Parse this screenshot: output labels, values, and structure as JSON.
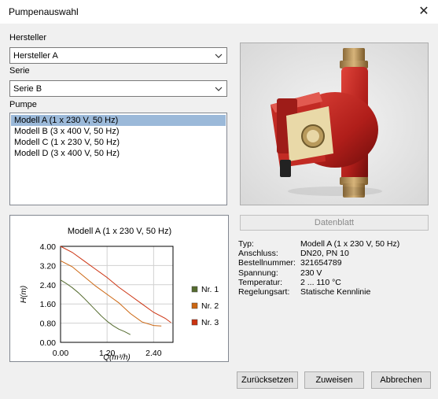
{
  "window": {
    "title": "Pumpenauswahl",
    "close_glyph": "✕"
  },
  "manufacturer": {
    "label": "Hersteller",
    "value": "Hersteller A"
  },
  "series": {
    "label": "Serie",
    "value": "Serie B"
  },
  "pump": {
    "label": "Pumpe",
    "items": [
      "Modell A (1 x 230 V, 50 Hz)",
      "Modell B (3 x 400 V, 50 Hz)",
      "Modell C (1 x 230 V, 50 Hz)",
      "Modell D (3 x 400 V, 50 Hz)"
    ],
    "selected_index": 0
  },
  "chart_data": {
    "type": "line",
    "title": "Modell A (1 x 230 V, 50 Hz)",
    "xlabel": "Q(m³/h)",
    "ylabel": "H(m)",
    "xlim": [
      0,
      2.9
    ],
    "ylim": [
      0,
      4.0
    ],
    "xticks": [
      "0.00",
      "1.20",
      "2.40"
    ],
    "yticks": [
      "0.00",
      "0.80",
      "1.60",
      "2.40",
      "3.20",
      "4.00"
    ],
    "grid": true,
    "legend_position": "right",
    "series": [
      {
        "name": "Nr. 1",
        "color": "#556b2f",
        "x": [
          0.0,
          0.15,
          0.3,
          0.45,
          0.6,
          0.75,
          0.9,
          1.05,
          1.2,
          1.35,
          1.5,
          1.65,
          1.8
        ],
        "y": [
          2.6,
          2.45,
          2.28,
          2.08,
          1.85,
          1.6,
          1.35,
          1.1,
          0.88,
          0.7,
          0.55,
          0.45,
          0.32
        ]
      },
      {
        "name": "Nr. 2",
        "color": "#cc6611",
        "x": [
          0.0,
          0.3,
          0.6,
          0.9,
          1.2,
          1.5,
          1.8,
          2.1,
          2.4,
          2.6
        ],
        "y": [
          3.4,
          3.15,
          2.75,
          2.35,
          2.0,
          1.65,
          1.2,
          0.85,
          0.7,
          0.68
        ]
      },
      {
        "name": "Nr. 3",
        "color": "#cc3311",
        "x": [
          0.0,
          0.3,
          0.6,
          0.9,
          1.2,
          1.5,
          1.8,
          2.1,
          2.4,
          2.7,
          2.85
        ],
        "y": [
          4.0,
          3.75,
          3.4,
          3.05,
          2.7,
          2.3,
          1.95,
          1.6,
          1.25,
          1.0,
          0.82
        ]
      }
    ]
  },
  "details": {
    "datasheet_label": "Datenblatt",
    "rows": [
      {
        "key": "Typ:",
        "value": "Modell A (1 x 230 V, 50 Hz)"
      },
      {
        "key": "Anschluss:",
        "value": "DN20, PN 10"
      },
      {
        "key": "Bestellnummer:",
        "value": "321654789"
      },
      {
        "key": "Spannung:",
        "value": "230 V"
      },
      {
        "key": "Temperatur:",
        "value": "2 ... 110 °C"
      },
      {
        "key": "Regelungsart:",
        "value": "Statische Kennlinie"
      }
    ]
  },
  "buttons": {
    "reset": "Zurücksetzen",
    "assign": "Zuweisen",
    "cancel": "Abbrechen"
  }
}
